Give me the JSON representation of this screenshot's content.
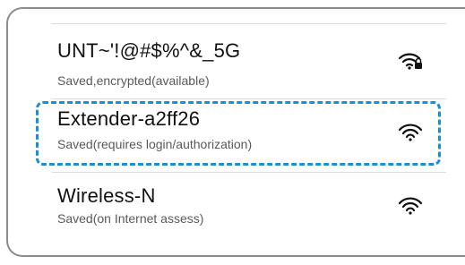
{
  "networks": [
    {
      "name": "UNT~'!@#$%^&_5G",
      "status": "Saved,encrypted(available)",
      "icon": "wifi-lock-icon"
    },
    {
      "name": "Extender-a2ff26",
      "status": "Saved(requires login/authorization)",
      "icon": "wifi-icon"
    },
    {
      "name": "Wireless-N",
      "status": "Saved(on Internet assess)",
      "icon": "wifi-icon"
    }
  ],
  "colors": {
    "highlight": "#1b8fd6",
    "frame": "#8c8c8c",
    "divider": "#dcdcdc"
  }
}
